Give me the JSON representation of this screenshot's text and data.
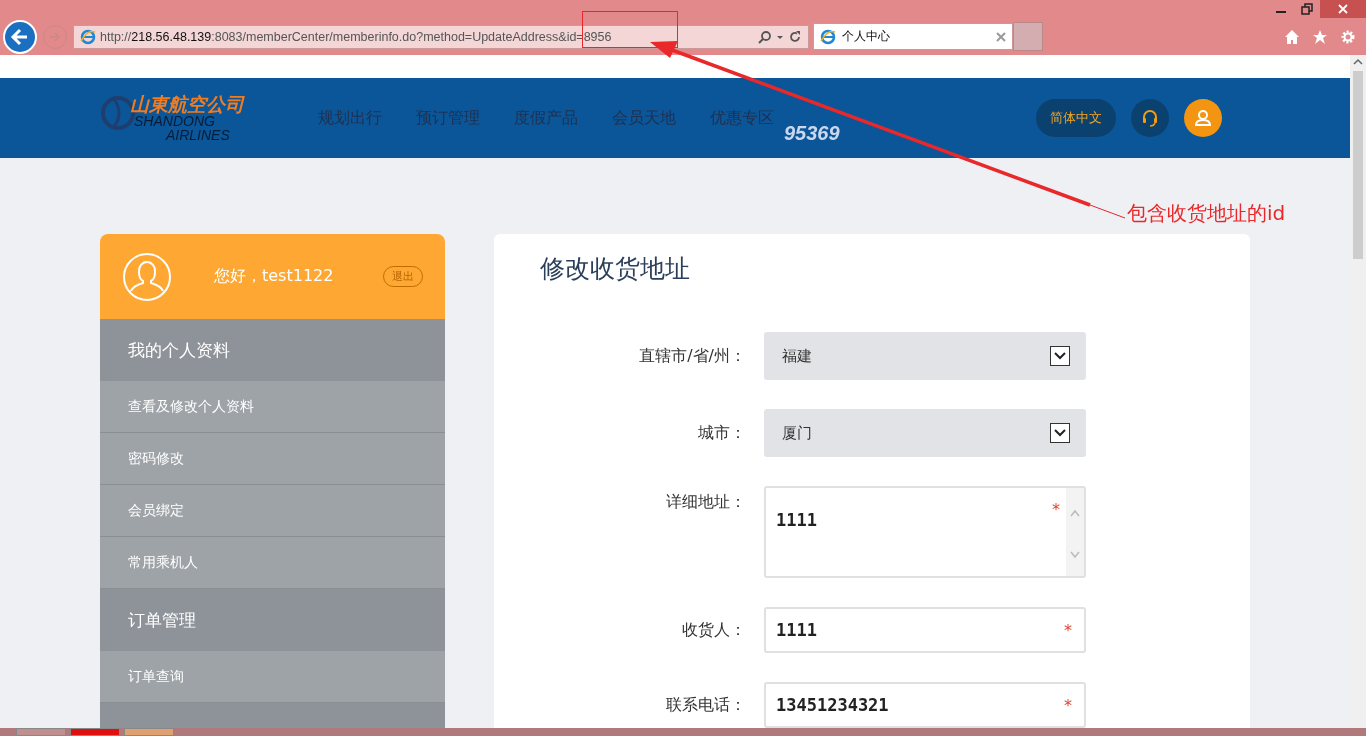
{
  "browser": {
    "url_prefix": "http://",
    "url_host": "218.56.48.139",
    "url_rest": ":8083/memberCenter/memberinfo.do?method=UpdateAddress&id=8956",
    "tab_title": "个人中心"
  },
  "header": {
    "logo_cn": "山東航空公司",
    "logo_en_1": "SHANDONG",
    "logo_en_2": "AIRLINES",
    "nav": [
      "规划出行",
      "预订管理",
      "度假产品",
      "会员天地",
      "优惠专区"
    ],
    "hotline": "95369",
    "language": "简体中文"
  },
  "user": {
    "greeting": "您好，test1122",
    "logout": "退出"
  },
  "sidebar": [
    {
      "kind": "section",
      "label": "我的个人资料"
    },
    {
      "kind": "item",
      "label": "查看及修改个人资料"
    },
    {
      "kind": "item",
      "label": "密码修改"
    },
    {
      "kind": "item",
      "label": "会员绑定"
    },
    {
      "kind": "item",
      "label": "常用乘机人"
    },
    {
      "kind": "section",
      "label": "订单管理"
    },
    {
      "kind": "item",
      "label": "订单查询"
    }
  ],
  "form": {
    "title": "修改收货地址",
    "fields": [
      {
        "kind": "select",
        "label": "直辖市/省/州：",
        "value": "福建"
      },
      {
        "kind": "select",
        "label": "城市：",
        "value": "厦门"
      },
      {
        "kind": "textarea",
        "label": "详细地址：",
        "value": "1111",
        "required_mark": "*"
      },
      {
        "kind": "input",
        "label": "收货人：",
        "value": "1111",
        "required_mark": "*"
      },
      {
        "kind": "input",
        "label": "联系电话：",
        "value": "13451234321",
        "required_mark": "*"
      }
    ]
  },
  "annotation": {
    "text": "包含收货地址的id"
  }
}
